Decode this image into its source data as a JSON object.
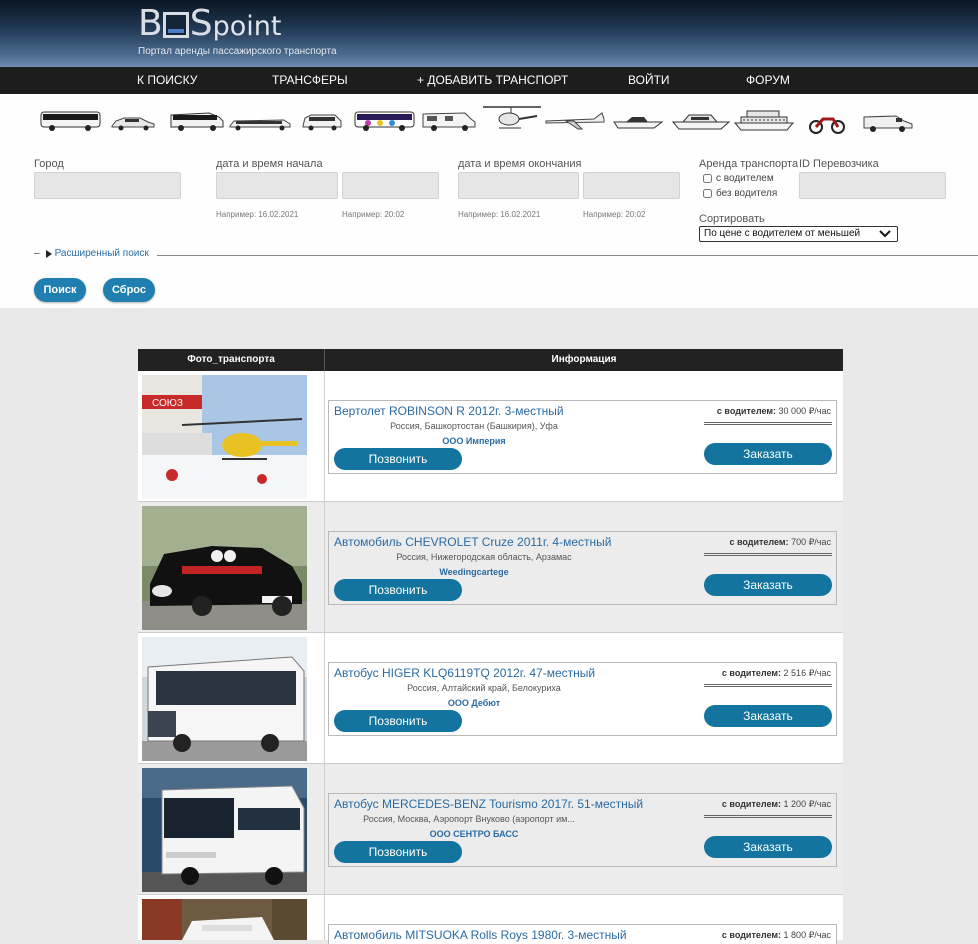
{
  "header": {
    "logo_b": "B",
    "logo_s": "S",
    "logo_point": "point",
    "tagline": "Портал аренды пассажирского транспорта",
    "background": "#1f3650"
  },
  "nav": {
    "items": [
      "К ПОИСКУ",
      "ТРАНСФЕРЫ",
      "+ ДОБАВИТЬ ТРАНСПОРТ",
      "ВОЙТИ",
      "ФОРУМ"
    ]
  },
  "vehicle_types": [
    "bus",
    "sedan",
    "minibus",
    "limousine",
    "minivan",
    "party-bus",
    "motorhome",
    "helicopter",
    "airplane",
    "speedboat",
    "yacht",
    "ship",
    "motorcycle",
    "van"
  ],
  "filters": {
    "city_label": "Город",
    "city_value": "",
    "start_label": "дата и время начала",
    "start_date_hint": "Например: 16.02.2021",
    "start_time_hint": "Например: 20:02",
    "end_label": "дата и время окончания",
    "end_date_hint": "Например: 16.02.2021",
    "end_time_hint": "Например: 20:02",
    "rent_label": "Аренда транспорта",
    "with_driver": "с водителем",
    "without_driver": "без водителя",
    "carrier_id_label": "ID Перевозчика",
    "sort_label": "Сортировать",
    "sort_value": "По цене с водителем от меньшей",
    "advanced_toggle": "–",
    "advanced_label": "Расширенный поиск",
    "search_button": "Поиск",
    "reset_button": "Сброс"
  },
  "table": {
    "col_photo": "Фото_транспорта",
    "col_info": "Информация",
    "call_label": "Позвонить",
    "order_label": "Заказать",
    "price_prefix": "с водителем:",
    "rows": [
      {
        "title": "Вертолет ROBINSON R 2012г. 3-местный",
        "location": "Россия, Башкортостан (Башкирия), Уфа",
        "org": "ООО Империя",
        "price": "30 000 ₽/час",
        "photo": "helicopter-photo"
      },
      {
        "title": "Автомобиль CHEVROLET Cruze 2011г. 4-местный",
        "location": "Россия, Нижегородская область, Арзамас",
        "org": "Weedingcartege",
        "price": "700 ₽/час",
        "photo": "car-photo"
      },
      {
        "title": "Автобус HIGER KLQ6119TQ 2012г. 47-местный",
        "location": "Россия, Алтайский край, Белокуриха",
        "org": "ООО Дебют",
        "price": "2 516 ₽/час",
        "photo": "bus-photo"
      },
      {
        "title": "Автобус MERCEDES-BENZ Tourismo 2017г. 51-местный",
        "location": "Россия, Москва, Аэропорт Внуково (аэропорт им...",
        "org": "ООО СЕНТРО БАСС",
        "price": "1 200 ₽/час",
        "photo": "bus-photo-2"
      },
      {
        "title": "Автомобиль MITSUOKA Rolls Roys 1980г. 3-местный",
        "location": "",
        "org": "",
        "price": "1 800 ₽/час",
        "photo": "limo-photo"
      }
    ]
  },
  "colors": {
    "accent": "#13759f",
    "link": "#2a6ba3",
    "nav_bg": "#1d1d1d",
    "page_bg": "#e9e9e9"
  }
}
